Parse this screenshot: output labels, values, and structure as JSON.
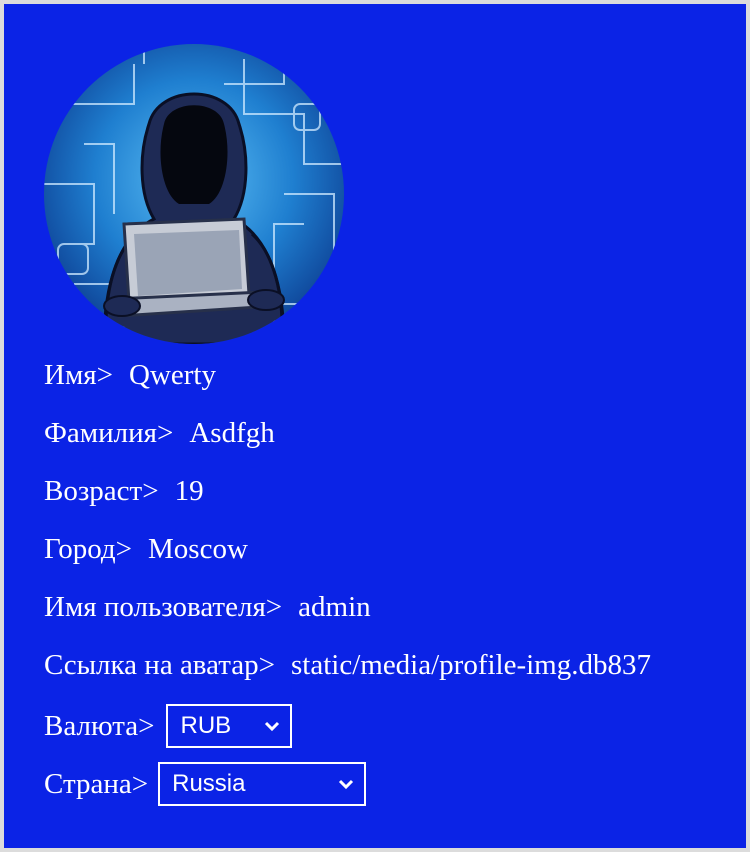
{
  "profile": {
    "avatar_icon": "hooded-hacker-avatar-icon",
    "fields": [
      {
        "label": "Имя>",
        "value": "Qwerty"
      },
      {
        "label": "Фамилия>",
        "value": "Asdfgh"
      },
      {
        "label": "Возраст>",
        "value": "19"
      },
      {
        "label": "Город>",
        "value": "Moscow"
      },
      {
        "label": "Имя пользователя>",
        "value": "admin"
      },
      {
        "label": "Ссылка на аватар>",
        "value": "static/media/profile-img.db837"
      }
    ],
    "currency": {
      "label": "Валюта>",
      "selected": "RUB"
    },
    "country": {
      "label": "Страна>",
      "selected": "Russia"
    }
  },
  "colors": {
    "panel": "#0b23e6",
    "frame": "#dcdcdc",
    "text": "#ffffff"
  }
}
